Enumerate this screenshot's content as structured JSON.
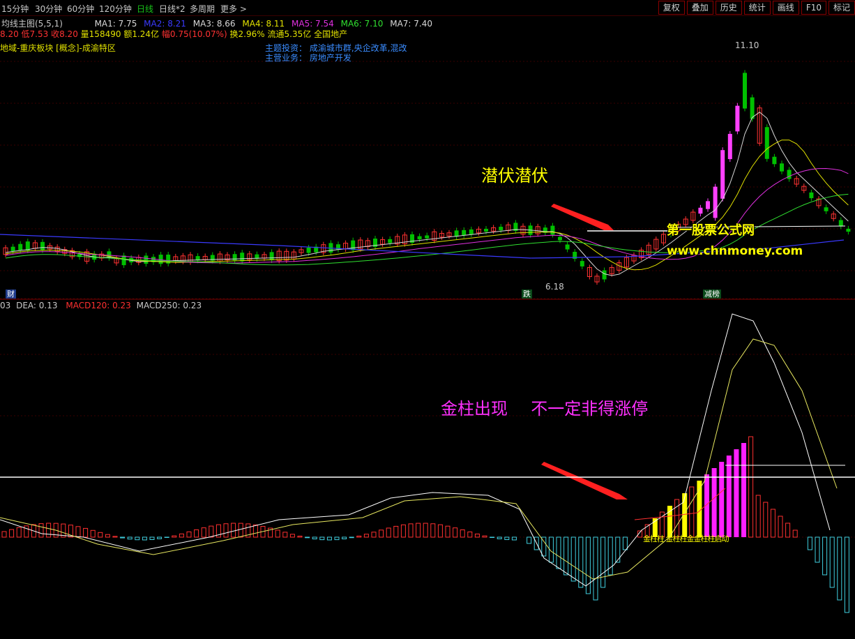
{
  "toolbar": {
    "timeframes": [
      "15分钟",
      "30分钟",
      "60分钟",
      "120分钟",
      "日线",
      "日线*2",
      "多周期",
      "更多 >"
    ],
    "right_buttons": [
      "复权",
      "叠加",
      "历史",
      "统计",
      "画线",
      "F10",
      "标记"
    ]
  },
  "main_panel": {
    "indicator_name": "均线主图(5,5,1)",
    "ma": [
      {
        "label": "MA1: 7.75",
        "color": "#d8d8d8"
      },
      {
        "label": "MA2: 8.21",
        "color": "#3a3aff"
      },
      {
        "label": "MA3: 8.66",
        "color": "#d8d8d8"
      },
      {
        "label": "MA4: 8.11",
        "color": "#e0e000"
      },
      {
        "label": "MA5: 7.54",
        "color": "#e030e0"
      },
      {
        "label": "MA6: 7.10",
        "color": "#30e030"
      },
      {
        "label": "MA7: 7.40",
        "color": "#d8d8d8"
      }
    ],
    "quote": {
      "open": "8.20",
      "low": "低7.53",
      "close": "收8.20",
      "volume": "量158490",
      "amount": "额1.24亿",
      "change": "幅0.75(10.07%)",
      "turnover": "换2.96%",
      "float_cap": "流通5.35亿",
      "sector": "全国地产"
    },
    "concepts": "地域-重庆板块 [概念]-成渝特区",
    "theme_label": "主题投资：",
    "theme_value": "成渝城市群,央企改革,混改",
    "business_label": "主营业务：",
    "business_value": "房地产开发",
    "high_label": "11.10",
    "low_label": "6.18",
    "tag_cai": "财",
    "tag_die": "跌",
    "tag_jian": "减榜",
    "annotation": "潜伏潜伏",
    "watermark_title": "第一股票公式网",
    "watermark_url": "www.chnmoney.com",
    "colors": {
      "up": "#ff3232",
      "down": "#00c000",
      "limit_up": "#ff40ff"
    }
  },
  "sub_panel": {
    "dif": "03",
    "dea": "DEA: 0.13",
    "macd120": "MACD120: 0.23",
    "macd250": "MACD250: 0.23",
    "annotation_left": "金柱出现",
    "annotation_right": "不一定非得涨停",
    "gold_labels": "金柱柱  金柱柱金金柱柱启动",
    "colors": {
      "gold": "#ffff00",
      "magenta": "#ff20ff",
      "red": "#ff3030",
      "cyan": "#40d0e0"
    }
  }
}
